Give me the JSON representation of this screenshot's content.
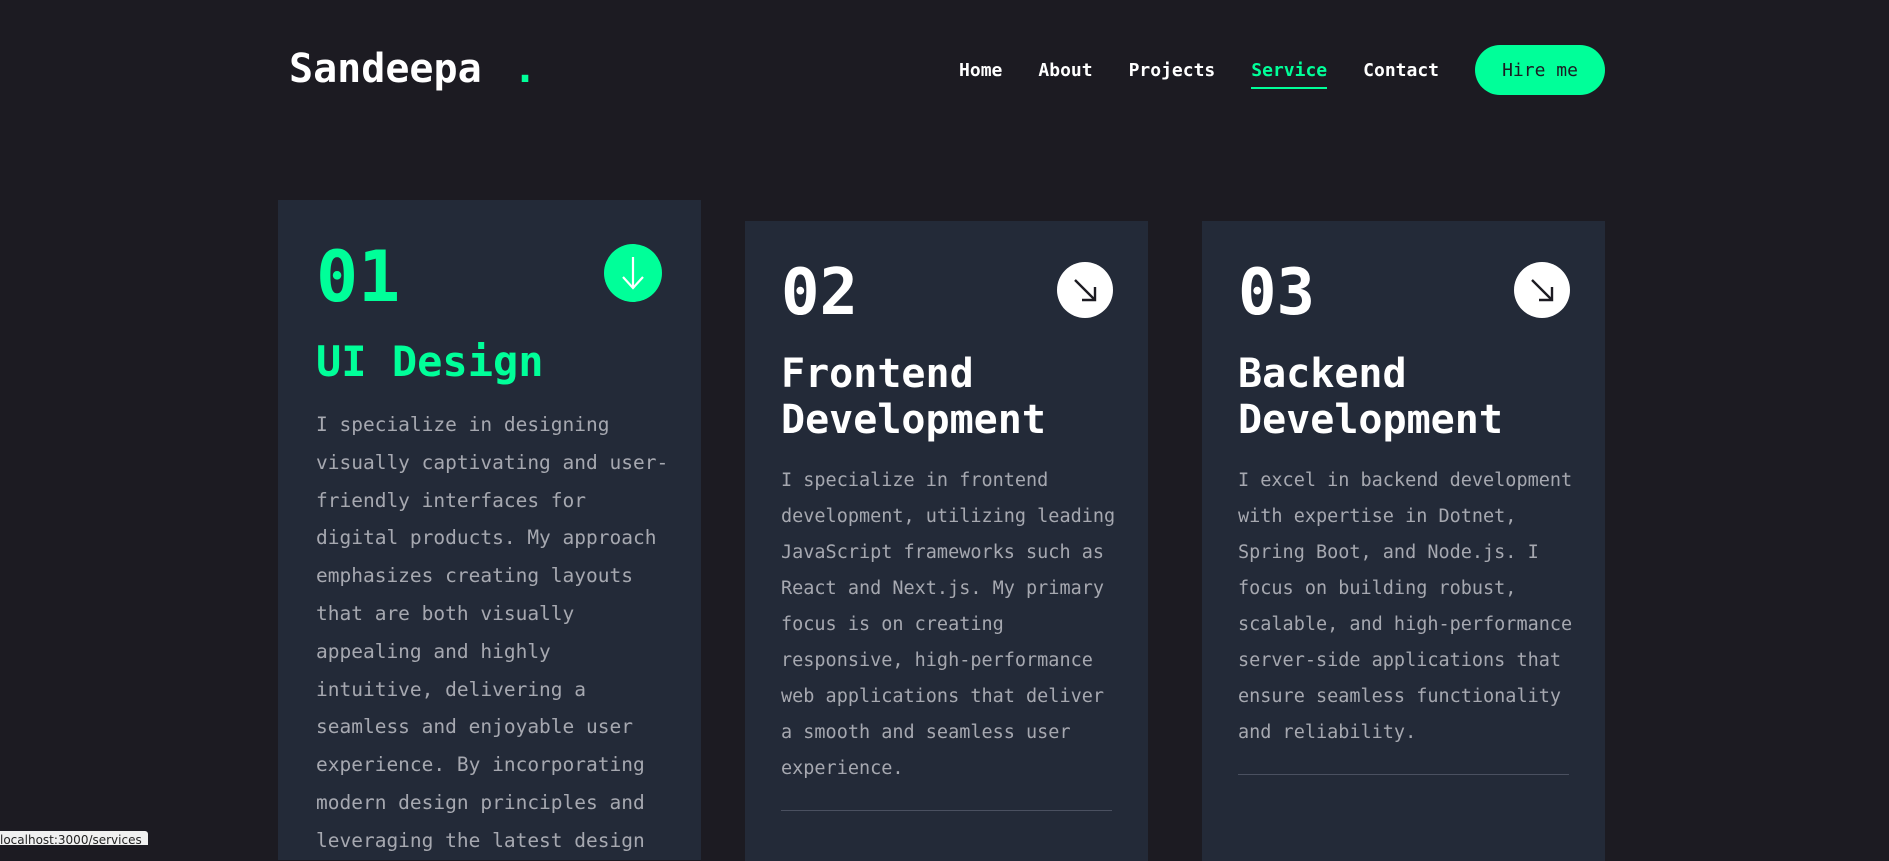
{
  "header": {
    "logo": "Sandeepa",
    "logo_dot": ".",
    "nav": [
      "Home",
      "About",
      "Projects",
      "Service",
      "Contact"
    ],
    "active_nav": "Service",
    "hire_label": "Hire me"
  },
  "colors": {
    "background": "#1c1b22",
    "card": "#232a38",
    "accent": "#00ff99",
    "text_muted": "#a6a8b0"
  },
  "services": [
    {
      "number": "01",
      "title": "UI Design",
      "description": "I specialize in designing visually captivating and user-friendly interfaces for digital products. My approach emphasizes creating layouts that are both visually appealing and highly intuitive, delivering a seamless and enjoyable user experience. By incorporating modern design principles and leveraging the latest design",
      "icon": "arrow-down-icon"
    },
    {
      "number": "02",
      "title": "Frontend Development",
      "description": "I specialize in frontend development, utilizing leading JavaScript frameworks such as React and Next.js. My primary focus is on creating responsive, high-performance web applications that deliver a smooth and seamless user experience.",
      "icon": "arrow-down-right-icon"
    },
    {
      "number": "03",
      "title": "Backend Development",
      "description": "I excel in backend development with expertise in Dotnet, Spring Boot, and Node.js. I focus on building robust, scalable, and high-performance server-side applications that ensure seamless functionality and reliability.",
      "icon": "arrow-down-right-icon"
    }
  ],
  "status_bar": "localhost:3000/services"
}
